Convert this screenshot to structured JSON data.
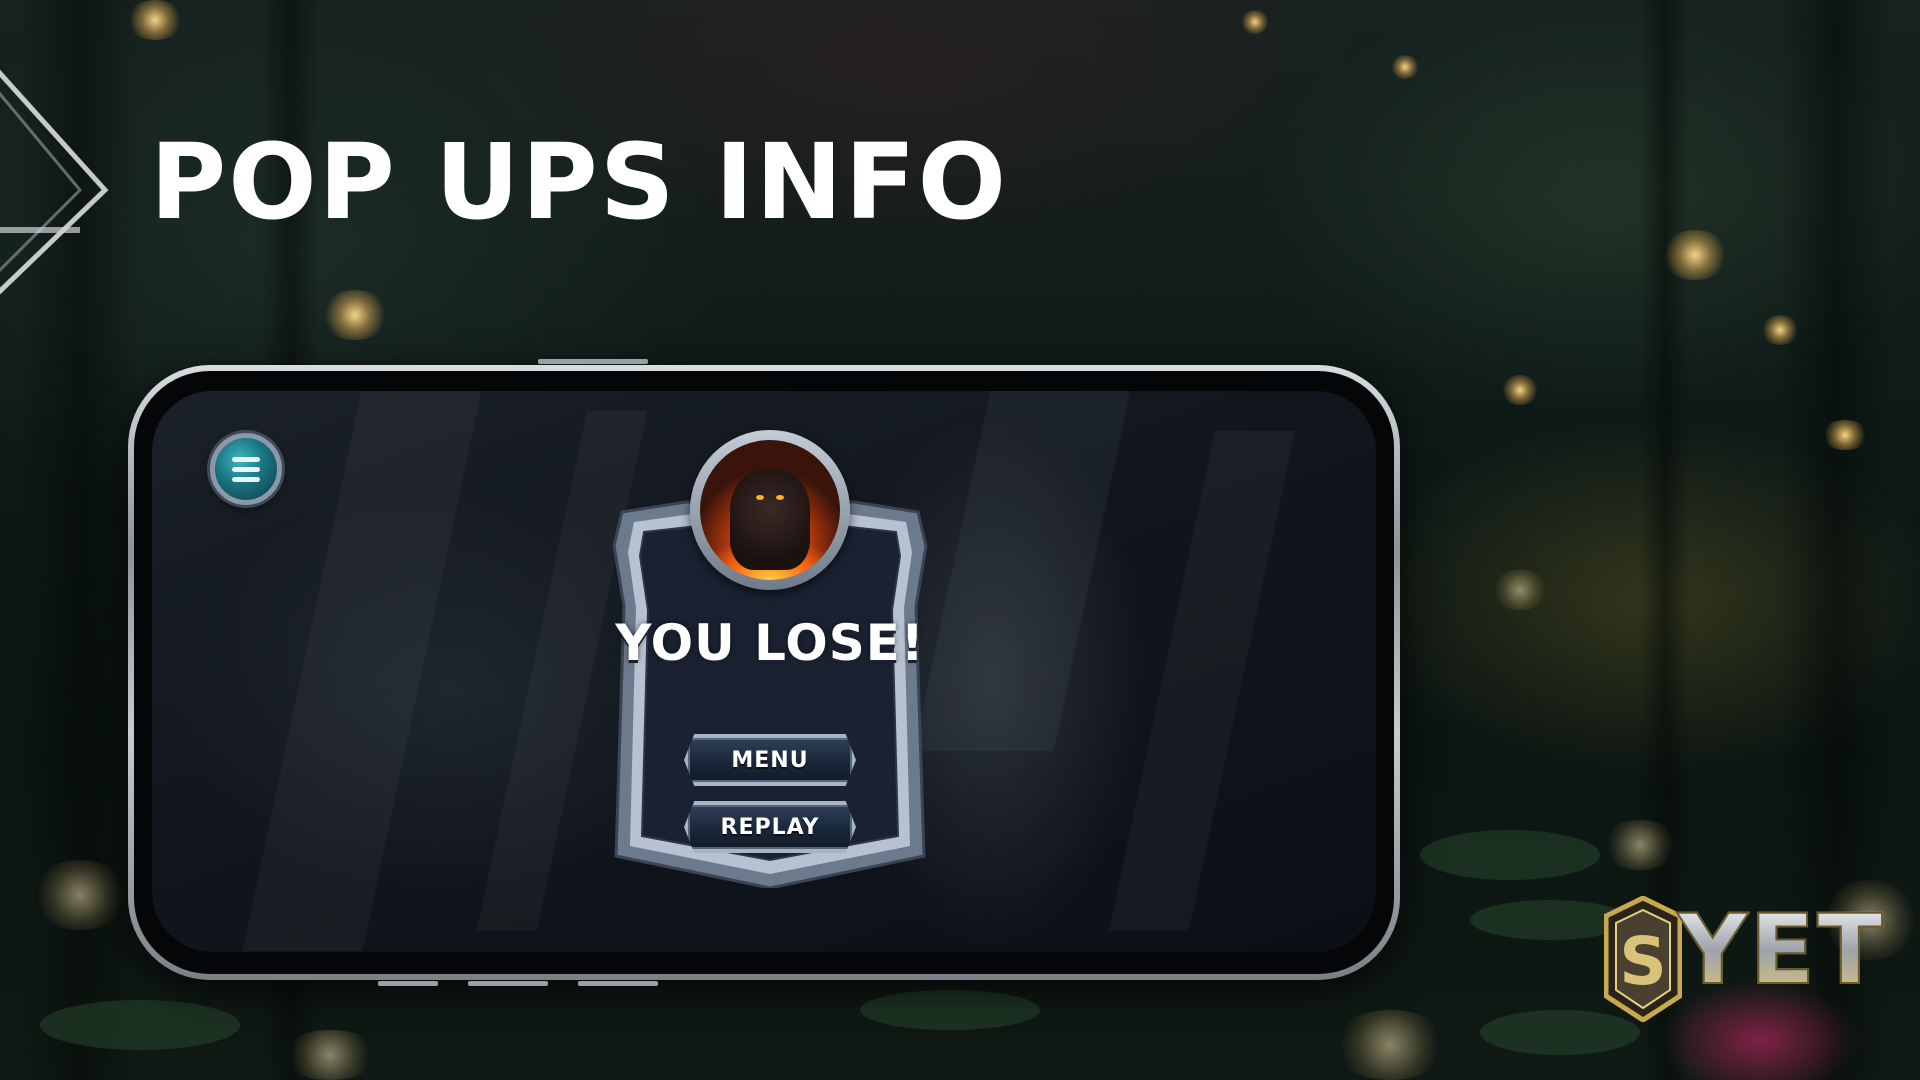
{
  "page": {
    "title": "POP UPS INFO"
  },
  "game": {
    "menu_button_icon": "hamburger-menu-icon",
    "popup": {
      "title": "YOU LOSE!",
      "avatar_icon": "lava-golem-avatar",
      "buttons": {
        "menu": "MENU",
        "replay": "REPLAY"
      }
    }
  },
  "brand": {
    "emblem": "S",
    "text": "YET"
  },
  "colors": {
    "accent_teal": "#1a7280",
    "frame_silver": "#a7b4c4",
    "button_navy": "#1a2739",
    "brand_gold": "#d6c17a"
  }
}
